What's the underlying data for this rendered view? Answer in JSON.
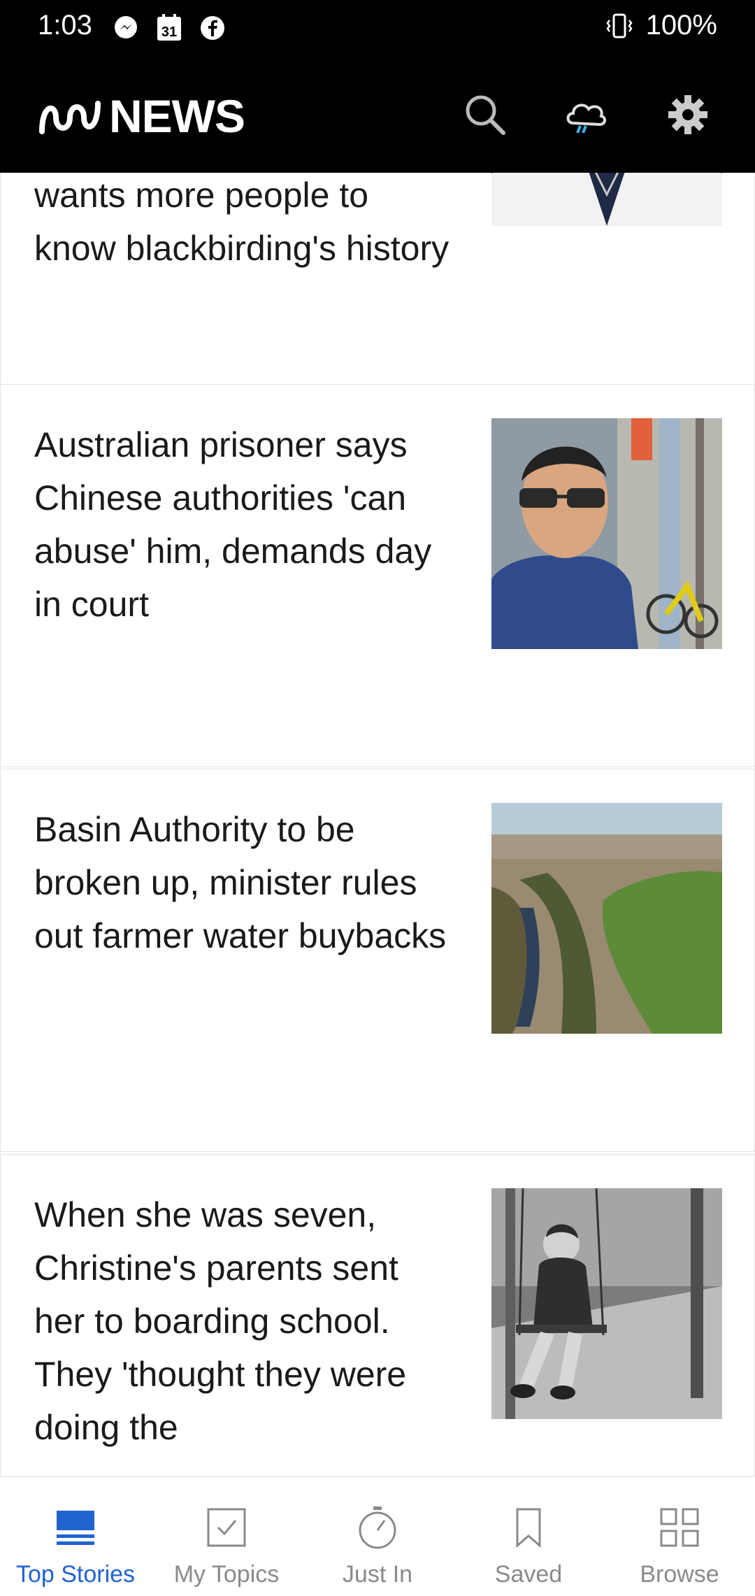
{
  "status_bar": {
    "time": "1:03",
    "battery": "100%",
    "left_icons": [
      "messenger-icon",
      "calendar-icon",
      "facebook-icon"
    ],
    "calendar_day": "31",
    "right_icons": [
      "vibrate-icon"
    ]
  },
  "app_bar": {
    "brand": "NEWS",
    "actions": [
      "search-icon",
      "weather-icon",
      "settings-icon"
    ]
  },
  "stories": [
    {
      "title": "wants more people to know blackbirding's history"
    },
    {
      "title": "Australian prisoner says Chinese authorities 'can abuse' him, demands day in court"
    },
    {
      "title": "Basin Authority to be broken up, minister rules out farmer water buybacks"
    },
    {
      "title": "When she was seven, Christine's parents sent her to boarding school. They 'thought they were doing the"
    }
  ],
  "bottom_nav": {
    "items": [
      {
        "label": "Top Stories",
        "icon": "top-stories-icon",
        "active": true
      },
      {
        "label": "My Topics",
        "icon": "checkbox-icon",
        "active": false
      },
      {
        "label": "Just In",
        "icon": "stopwatch-icon",
        "active": false
      },
      {
        "label": "Saved",
        "icon": "bookmark-icon",
        "active": false
      },
      {
        "label": "Browse",
        "icon": "grid-icon",
        "active": false
      }
    ]
  },
  "colors": {
    "header_bg": "#000000",
    "accent": "#2162d1",
    "inactive": "#8a8a8a"
  }
}
